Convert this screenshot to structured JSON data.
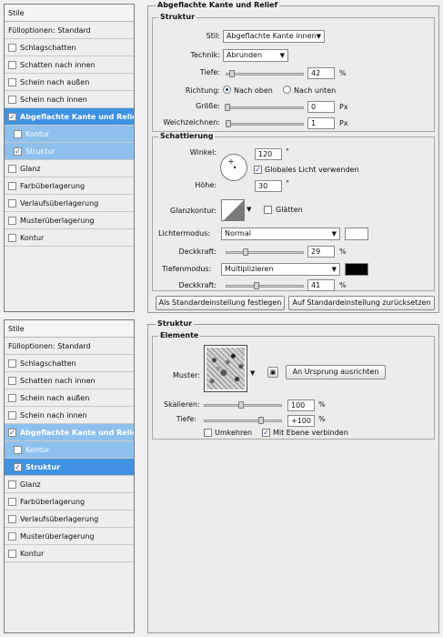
{
  "top": {
    "list": {
      "title": "Stile",
      "fill_options": "Fülloptionen: Standard",
      "items": [
        {
          "label": "Schlagschatten",
          "checked": false
        },
        {
          "label": "Schatten nach innen",
          "checked": false
        },
        {
          "label": "Schein nach außen",
          "checked": false
        },
        {
          "label": "Schein nach innen",
          "checked": false
        },
        {
          "label": "Abgeflachte Kante und Relief",
          "checked": true
        },
        {
          "label": "Kontur",
          "checked": false
        },
        {
          "label": "Struktur",
          "checked": true
        },
        {
          "label": "Glanz",
          "checked": false
        },
        {
          "label": "Farbüberlagerung",
          "checked": false
        },
        {
          "label": "Verlaufsüberlagerung",
          "checked": false
        },
        {
          "label": "Musterüberlagerung",
          "checked": false
        },
        {
          "label": "Kontur",
          "checked": false
        }
      ]
    },
    "bevel": {
      "title": "Abgeflachte Kante und Relief",
      "structure": {
        "title": "Struktur",
        "style_label": "Stil:",
        "style_value": "Abgeflachte Kante innen",
        "technique_label": "Technik:",
        "technique_value": "Abrunden",
        "depth_label": "Tiefe:",
        "depth_value": "42",
        "depth_unit": "%",
        "direction_label": "Richtung:",
        "direction_up": "Nach oben",
        "direction_down": "Nach unten",
        "size_label": "Größe:",
        "size_value": "0",
        "size_unit": "Px",
        "soften_label": "Weichzeichnen:",
        "soften_value": "1",
        "soften_unit": "Px"
      },
      "shading": {
        "title": "Schattierung",
        "angle_label": "Winkel:",
        "angle_value": "120",
        "angle_unit": "°",
        "global_light": "Globales Licht verwenden",
        "altitude_label": "Höhe:",
        "altitude_value": "30",
        "altitude_unit": "°",
        "gloss_label": "Glanzkontur:",
        "anti_alias": "Glätten",
        "highlight_mode_label": "Lichtermodus:",
        "highlight_mode_value": "Normal",
        "highlight_opacity_label": "Deckkraft:",
        "highlight_opacity_value": "29",
        "highlight_opacity_unit": "%",
        "shadow_mode_label": "Tiefenmodus:",
        "shadow_mode_value": "Multiplizieren",
        "shadow_opacity_label": "Deckkraft:",
        "shadow_opacity_value": "41",
        "shadow_opacity_unit": "%",
        "highlight_color": "#ffffff",
        "shadow_color": "#000000"
      },
      "make_default": "Als Standardeinstellung festlegen",
      "reset_default": "Auf Standardeinstellung zurücksetzen"
    }
  },
  "bottom": {
    "list": {
      "title": "Stile",
      "fill_options": "Fülloptionen: Standard",
      "items": [
        {
          "label": "Schlagschatten",
          "checked": false
        },
        {
          "label": "Schatten nach innen",
          "checked": false
        },
        {
          "label": "Schein nach außen",
          "checked": false
        },
        {
          "label": "Schein nach innen",
          "checked": false
        },
        {
          "label": "Abgeflachte Kante und Relief",
          "checked": true
        },
        {
          "label": "Kontur",
          "checked": false
        },
        {
          "label": "Struktur",
          "checked": true
        },
        {
          "label": "Glanz",
          "checked": false
        },
        {
          "label": "Farbüberlagerung",
          "checked": false
        },
        {
          "label": "Verlaufsüberlagerung",
          "checked": false
        },
        {
          "label": "Musterüberlagerung",
          "checked": false
        },
        {
          "label": "Kontur",
          "checked": false
        }
      ]
    },
    "texture": {
      "title": "Struktur",
      "elements_title": "Elemente",
      "pattern_label": "Muster:",
      "snap_origin": "An Ursprung ausrichten",
      "scale_label": "Skalieren:",
      "scale_value": "100",
      "scale_unit": "%",
      "depth_label": "Tiefe:",
      "depth_value": "+100",
      "depth_unit": "%",
      "invert": "Umkehren",
      "link_layer": "Mit Ebene verbinden"
    }
  }
}
